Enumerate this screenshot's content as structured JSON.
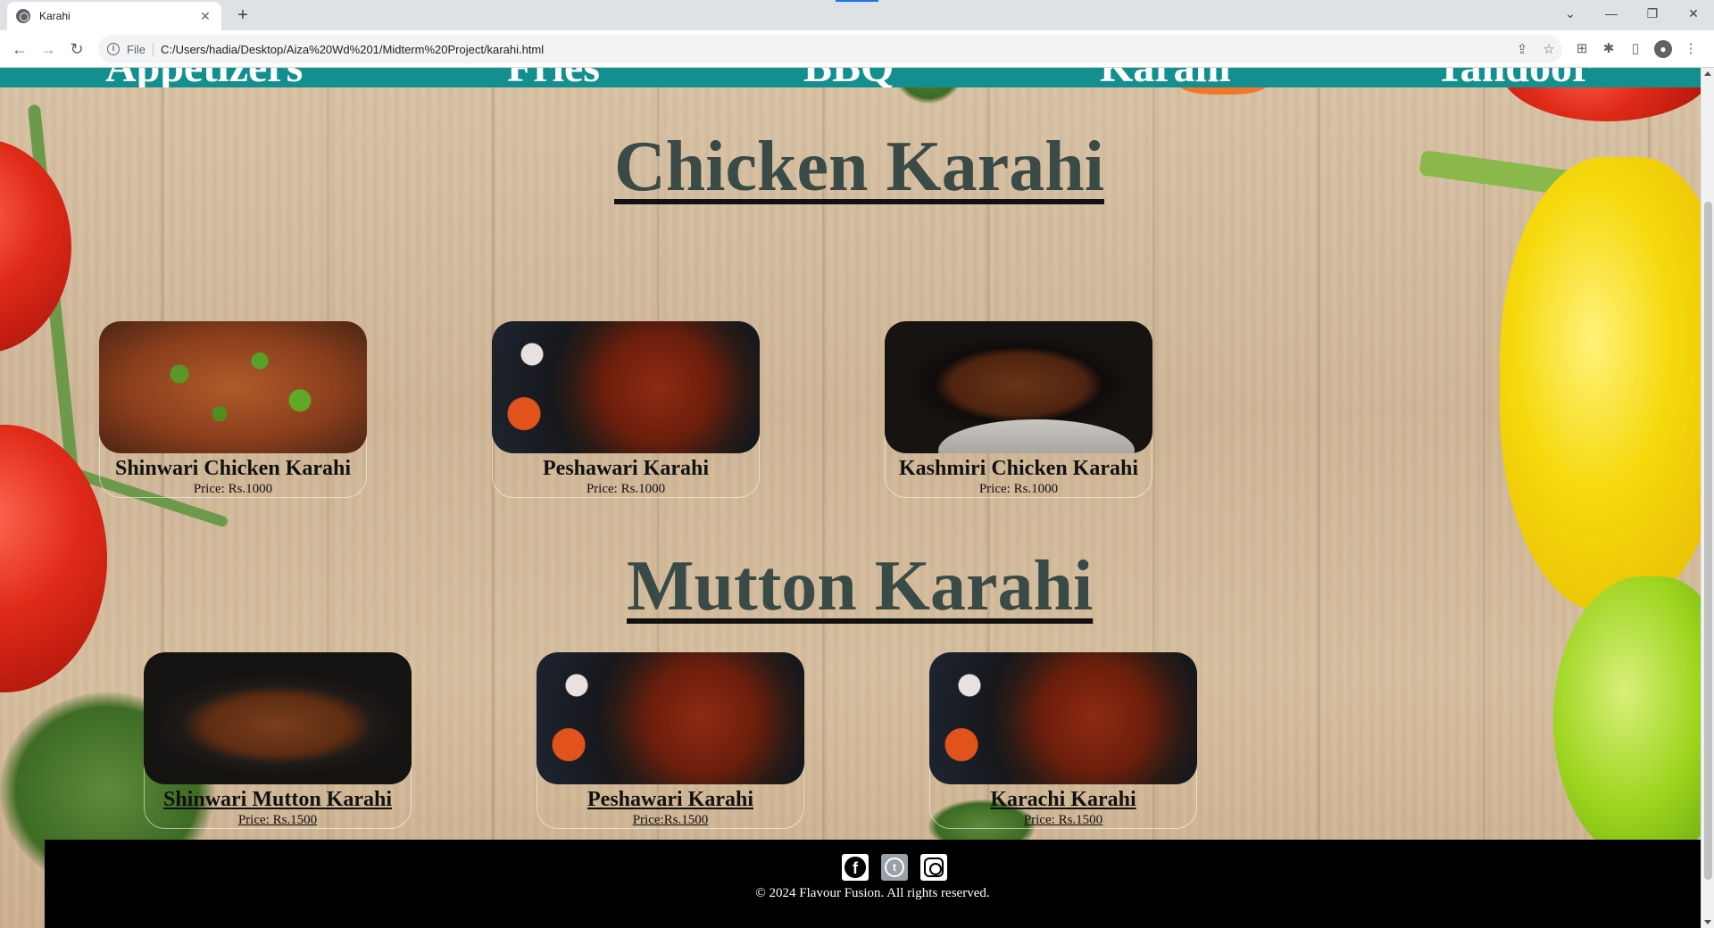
{
  "browser": {
    "tab_title": "Karahi",
    "tab_close": "✕",
    "new_tab": "+",
    "url_scheme": "File",
    "url": "C:/Users/hadia/Desktop/Aiza%20Wd%201/Midterm%20Project/karahi.html",
    "controls": {
      "dropdown": "⌄",
      "minimize": "—",
      "restore": "❐",
      "close": "✕"
    },
    "nav": {
      "back": "←",
      "forward": "→",
      "reload": "↻"
    }
  },
  "navbar": {
    "links": [
      "Appetizers",
      "Fries",
      "BBQ",
      "Karahi",
      "Tandoor"
    ],
    "bg_color": "#138f8f"
  },
  "sections": [
    {
      "title": "Chicken Karahi",
      "items": [
        {
          "name": "Shinwari Chicken Karahi",
          "price": "Price: Rs.1000"
        },
        {
          "name": "Peshawari Karahi",
          "price": "Price: Rs.1000"
        },
        {
          "name": "Kashmiri Chicken Karahi",
          "price": "Price: Rs.1000"
        }
      ]
    },
    {
      "title": "Mutton Karahi",
      "items": [
        {
          "name": "Shinwari Mutton Karahi",
          "price": "Price: Rs.1500"
        },
        {
          "name": "Peshawari Karahi",
          "price": "Price:Rs.1500"
        },
        {
          "name": "Karachi Karahi",
          "price": "Price: Rs.1500"
        }
      ]
    }
  ],
  "footer": {
    "social": [
      {
        "icon": "facebook-icon",
        "glyph": "f"
      },
      {
        "icon": "twitter-icon",
        "glyph": "t"
      },
      {
        "icon": "instagram-icon",
        "glyph": ""
      }
    ],
    "copyright": "© 2024 Flavour Fusion. All rights reserved."
  }
}
